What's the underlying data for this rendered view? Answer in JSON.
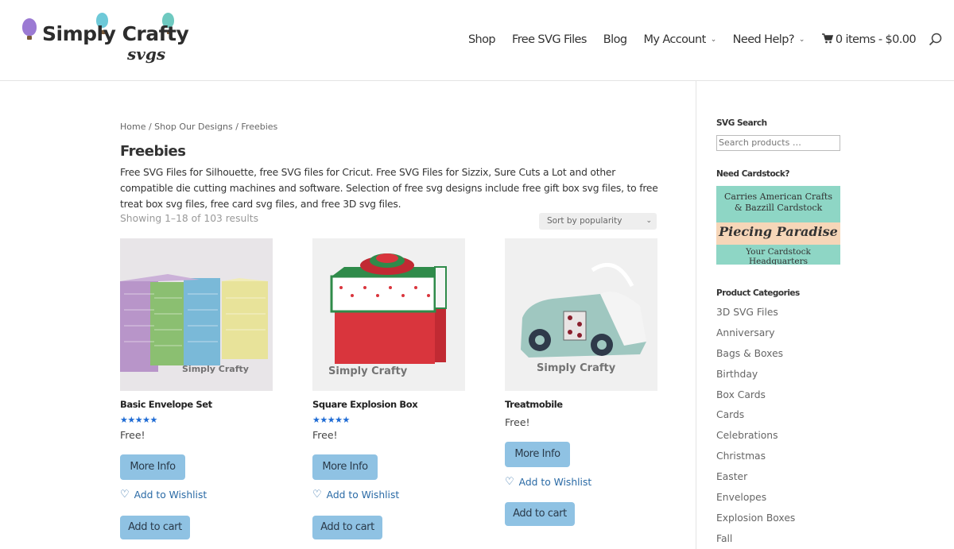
{
  "header": {
    "logo_text": "Simply Crafty",
    "logo_sub": "svgs",
    "nav": [
      {
        "label": "Shop",
        "dropdown": false
      },
      {
        "label": "Free SVG Files",
        "dropdown": false
      },
      {
        "label": "Blog",
        "dropdown": false
      },
      {
        "label": "My Account",
        "dropdown": true
      },
      {
        "label": "Need Help?",
        "dropdown": true
      }
    ],
    "cart_label": "0 items - $0.00"
  },
  "breadcrumb": "Home / Shop Our Designs / Freebies",
  "page_title": "Freebies",
  "description": "Free SVG Files for Silhouette, free SVG files for Cricut. Free SVG Files for Sizzix, Sure Cuts a Lot and other compatible die cutting machines and software. Selection of free svg designs include free gift box svg files, to free treat box svg files, free card svg files, and free 3D svg files.",
  "result_count": "Showing 1–18 of 103 results",
  "sort": {
    "selected": "Sort by popularity"
  },
  "products": [
    {
      "title": "Basic Envelope Set",
      "rating_stars": "★★★★★",
      "price": "Free!",
      "more_info": "More Info",
      "wishlist": "Add to Wishlist",
      "add_to_cart": "Add to cart",
      "watermark": "Simply Crafty"
    },
    {
      "title": "Square Explosion Box",
      "rating_stars": "★★★★★",
      "price": "Free!",
      "more_info": "More Info",
      "wishlist": "Add to Wishlist",
      "add_to_cart": "Add to cart",
      "watermark": "Simply Crafty"
    },
    {
      "title": "Treatmobile",
      "rating_stars": "",
      "price": "Free!",
      "more_info": "More Info",
      "wishlist": "Add to Wishlist",
      "add_to_cart": "Add to cart",
      "watermark": "Simply Crafty"
    }
  ],
  "sidebar": {
    "search_title": "SVG Search",
    "search_placeholder": "Search products …",
    "cardstock_title": "Need Cardstock?",
    "banner_line1": "Carries American Crafts",
    "banner_line2": "& Bazzill Cardstock",
    "banner_script": "Piecing Paradise",
    "banner_line3": "Your Cardstock Headquarters",
    "categories_title": "Product Categories",
    "categories": [
      "3D SVG Files",
      "Anniversary",
      "Bags & Boxes",
      "Birthday",
      "Box Cards",
      "Cards",
      "Celebrations",
      "Christmas",
      "Easter",
      "Envelopes",
      "Explosion Boxes",
      "Fall"
    ]
  },
  "colors": {
    "button": "#8fc2e3",
    "star": "#1e6bd4",
    "link": "#2a6aa5"
  }
}
